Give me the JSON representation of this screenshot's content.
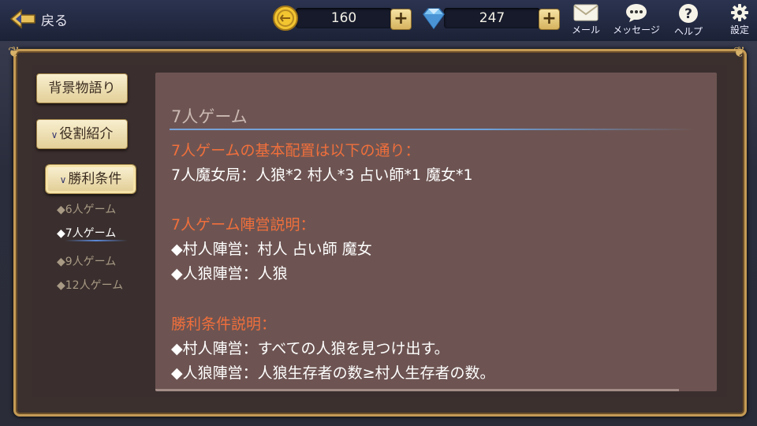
{
  "header": {
    "back_label": "戻る",
    "gold_count": "160",
    "gem_count": "247",
    "plus_label": "+",
    "mail_label": "メール",
    "message_label": "メッセージ",
    "help_label": "ヘルプ",
    "settings_label": "設定"
  },
  "sidebar": {
    "background_story": "背景物語り",
    "role_intro": "役割紹介",
    "win_conditions": "勝利条件",
    "chevron": "∨",
    "sub_items": [
      "◆6人ゲーム",
      "◆7人ゲーム",
      "◆9人ゲーム",
      "◆12人ゲーム"
    ]
  },
  "content": {
    "title": "7人ゲーム",
    "lines": [
      "7人ゲームの基本配置は以下の通り：",
      "7人魔女局：人狼*2  村人*3  占い師*1  魔女*1",
      "7人ゲーム陣営説明：",
      "◆村人陣営：村人  占い師  魔女",
      "◆人狼陣営：人狼",
      "勝利条件説明：",
      "◆村人陣営：すべての人狼を見つけ出す。",
      "◆人狼陣営：人狼生存者の数≥村人生存者の数。"
    ]
  },
  "colors": {
    "accent_orange": "#f06f3c",
    "frame_gold": "#c49a55",
    "panel_bg": "#6d5452"
  }
}
